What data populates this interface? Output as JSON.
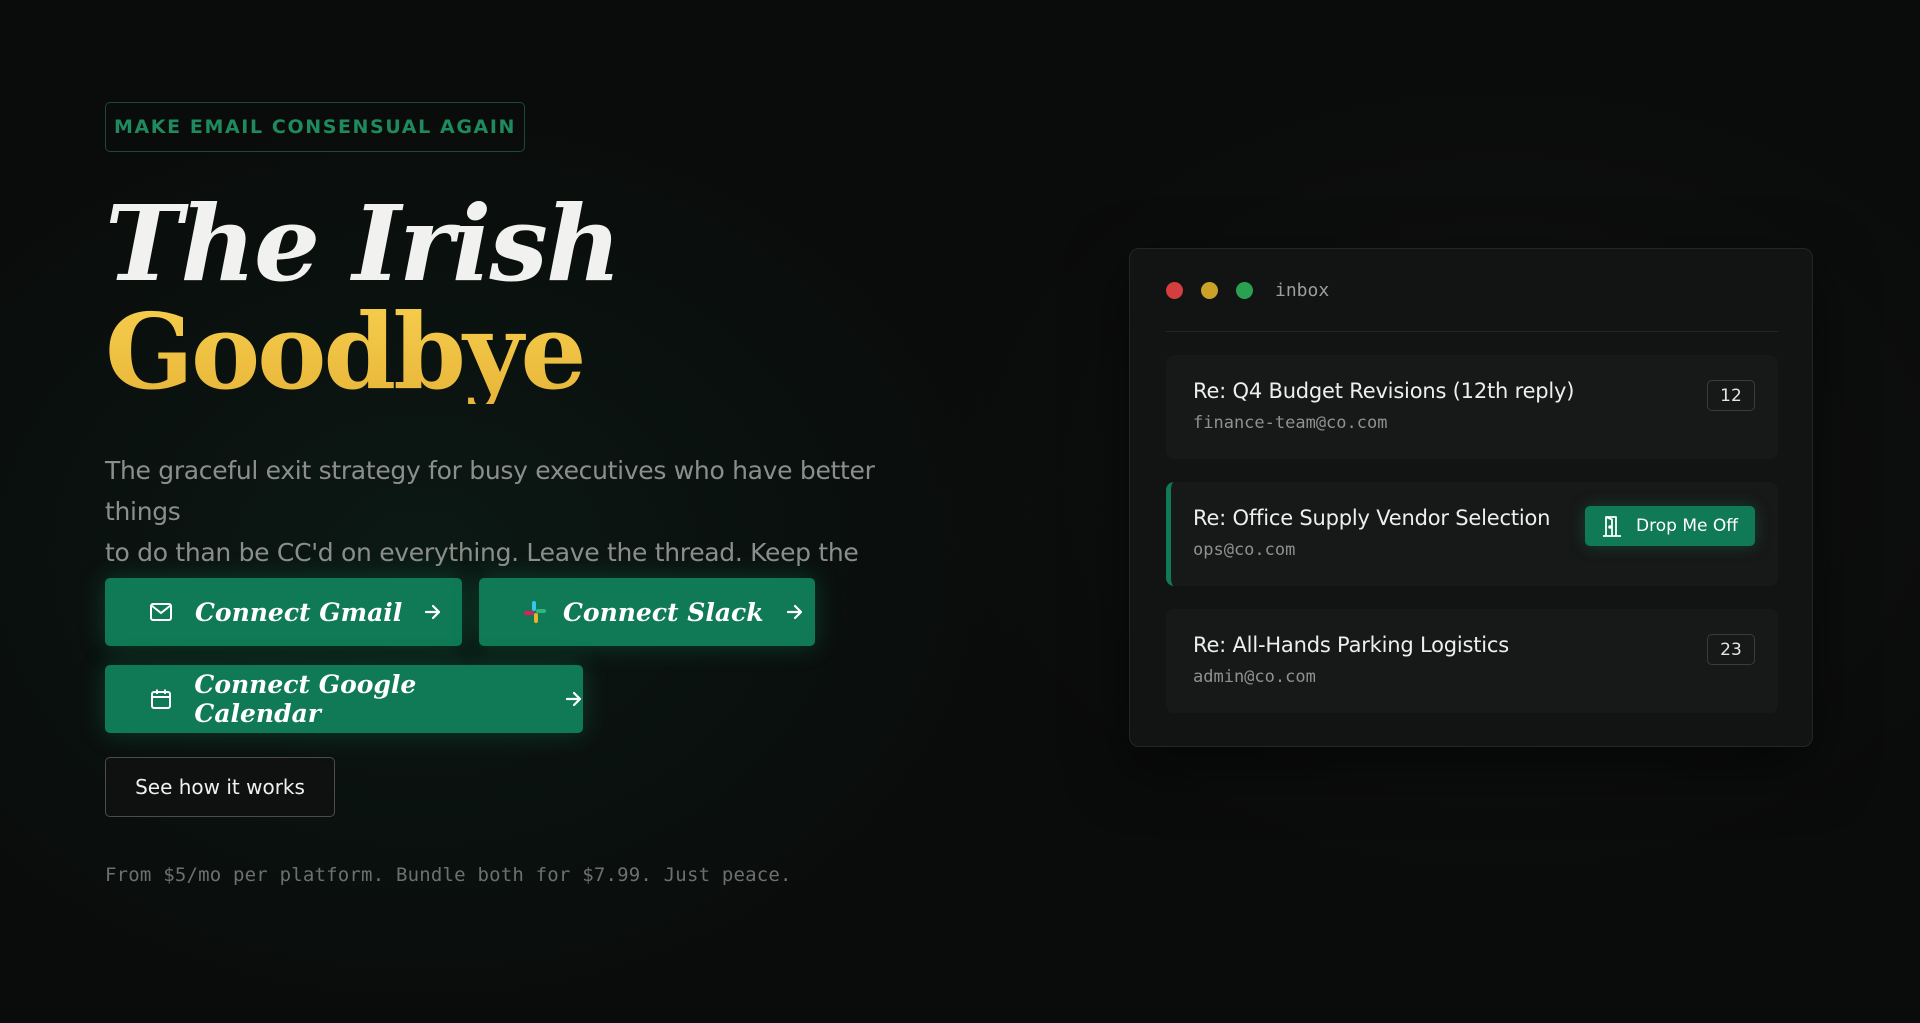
{
  "hero": {
    "tagline": "MAKE EMAIL CONSENSUAL AGAIN",
    "title_line1": "The Irish",
    "title_line2": "Goodbye",
    "subtitle_line1": "The graceful exit strategy for busy executives who have better things",
    "subtitle_line2": "to do than be CC'd on everything. Leave the thread. Keep the dignity.",
    "connect_buttons": [
      {
        "label": "Connect Gmail",
        "icon": "mail-icon"
      },
      {
        "label": "Connect Slack",
        "icon": "slack-icon"
      },
      {
        "label": "Connect Google Calendar",
        "icon": "calendar-icon"
      }
    ],
    "secondary_button": "See how it works",
    "pricing": "From $5/mo per platform. Bundle both for $7.99. Just peace."
  },
  "inbox": {
    "title": "inbox",
    "emails": [
      {
        "subject": "Re: Q4 Budget Revisions (12th reply)",
        "from": "finance-team@co.com",
        "count": "12"
      },
      {
        "subject": "Re: Office Supply Vendor Selection",
        "from": "ops@co.com",
        "action": "Drop Me Off",
        "action_icon": "door-exit-icon"
      },
      {
        "subject": "Re: All-Hands Parking Logistics",
        "from": "admin@co.com",
        "count": "23"
      }
    ]
  },
  "colors": {
    "accent_green": "#0f7a55",
    "title_yellow": "#f0c23f",
    "background": "#0a0b0b"
  }
}
